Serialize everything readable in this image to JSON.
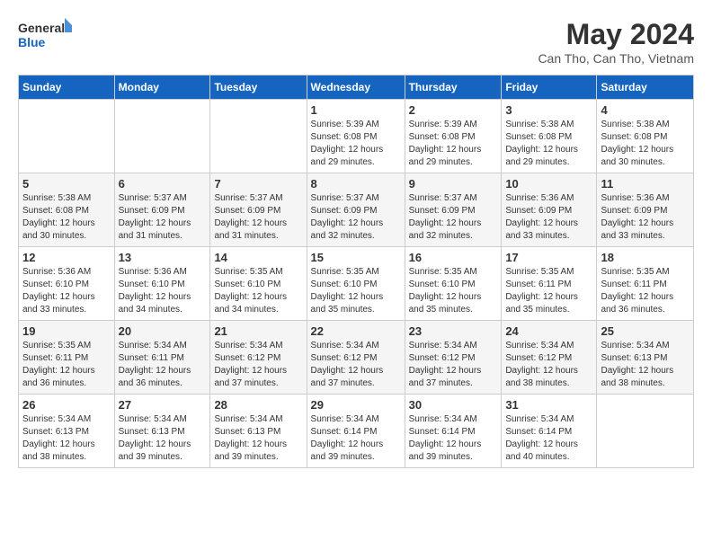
{
  "header": {
    "logo_line1": "General",
    "logo_line2": "Blue",
    "month_title": "May 2024",
    "location": "Can Tho, Can Tho, Vietnam"
  },
  "weekdays": [
    "Sunday",
    "Monday",
    "Tuesday",
    "Wednesday",
    "Thursday",
    "Friday",
    "Saturday"
  ],
  "weeks": [
    [
      {
        "day": "",
        "info": ""
      },
      {
        "day": "",
        "info": ""
      },
      {
        "day": "",
        "info": ""
      },
      {
        "day": "1",
        "info": "Sunrise: 5:39 AM\nSunset: 6:08 PM\nDaylight: 12 hours\nand 29 minutes."
      },
      {
        "day": "2",
        "info": "Sunrise: 5:39 AM\nSunset: 6:08 PM\nDaylight: 12 hours\nand 29 minutes."
      },
      {
        "day": "3",
        "info": "Sunrise: 5:38 AM\nSunset: 6:08 PM\nDaylight: 12 hours\nand 29 minutes."
      },
      {
        "day": "4",
        "info": "Sunrise: 5:38 AM\nSunset: 6:08 PM\nDaylight: 12 hours\nand 30 minutes."
      }
    ],
    [
      {
        "day": "5",
        "info": "Sunrise: 5:38 AM\nSunset: 6:08 PM\nDaylight: 12 hours\nand 30 minutes."
      },
      {
        "day": "6",
        "info": "Sunrise: 5:37 AM\nSunset: 6:09 PM\nDaylight: 12 hours\nand 31 minutes."
      },
      {
        "day": "7",
        "info": "Sunrise: 5:37 AM\nSunset: 6:09 PM\nDaylight: 12 hours\nand 31 minutes."
      },
      {
        "day": "8",
        "info": "Sunrise: 5:37 AM\nSunset: 6:09 PM\nDaylight: 12 hours\nand 32 minutes."
      },
      {
        "day": "9",
        "info": "Sunrise: 5:37 AM\nSunset: 6:09 PM\nDaylight: 12 hours\nand 32 minutes."
      },
      {
        "day": "10",
        "info": "Sunrise: 5:36 AM\nSunset: 6:09 PM\nDaylight: 12 hours\nand 33 minutes."
      },
      {
        "day": "11",
        "info": "Sunrise: 5:36 AM\nSunset: 6:09 PM\nDaylight: 12 hours\nand 33 minutes."
      }
    ],
    [
      {
        "day": "12",
        "info": "Sunrise: 5:36 AM\nSunset: 6:10 PM\nDaylight: 12 hours\nand 33 minutes."
      },
      {
        "day": "13",
        "info": "Sunrise: 5:36 AM\nSunset: 6:10 PM\nDaylight: 12 hours\nand 34 minutes."
      },
      {
        "day": "14",
        "info": "Sunrise: 5:35 AM\nSunset: 6:10 PM\nDaylight: 12 hours\nand 34 minutes."
      },
      {
        "day": "15",
        "info": "Sunrise: 5:35 AM\nSunset: 6:10 PM\nDaylight: 12 hours\nand 35 minutes."
      },
      {
        "day": "16",
        "info": "Sunrise: 5:35 AM\nSunset: 6:10 PM\nDaylight: 12 hours\nand 35 minutes."
      },
      {
        "day": "17",
        "info": "Sunrise: 5:35 AM\nSunset: 6:11 PM\nDaylight: 12 hours\nand 35 minutes."
      },
      {
        "day": "18",
        "info": "Sunrise: 5:35 AM\nSunset: 6:11 PM\nDaylight: 12 hours\nand 36 minutes."
      }
    ],
    [
      {
        "day": "19",
        "info": "Sunrise: 5:35 AM\nSunset: 6:11 PM\nDaylight: 12 hours\nand 36 minutes."
      },
      {
        "day": "20",
        "info": "Sunrise: 5:34 AM\nSunset: 6:11 PM\nDaylight: 12 hours\nand 36 minutes."
      },
      {
        "day": "21",
        "info": "Sunrise: 5:34 AM\nSunset: 6:12 PM\nDaylight: 12 hours\nand 37 minutes."
      },
      {
        "day": "22",
        "info": "Sunrise: 5:34 AM\nSunset: 6:12 PM\nDaylight: 12 hours\nand 37 minutes."
      },
      {
        "day": "23",
        "info": "Sunrise: 5:34 AM\nSunset: 6:12 PM\nDaylight: 12 hours\nand 37 minutes."
      },
      {
        "day": "24",
        "info": "Sunrise: 5:34 AM\nSunset: 6:12 PM\nDaylight: 12 hours\nand 38 minutes."
      },
      {
        "day": "25",
        "info": "Sunrise: 5:34 AM\nSunset: 6:13 PM\nDaylight: 12 hours\nand 38 minutes."
      }
    ],
    [
      {
        "day": "26",
        "info": "Sunrise: 5:34 AM\nSunset: 6:13 PM\nDaylight: 12 hours\nand 38 minutes."
      },
      {
        "day": "27",
        "info": "Sunrise: 5:34 AM\nSunset: 6:13 PM\nDaylight: 12 hours\nand 39 minutes."
      },
      {
        "day": "28",
        "info": "Sunrise: 5:34 AM\nSunset: 6:13 PM\nDaylight: 12 hours\nand 39 minutes."
      },
      {
        "day": "29",
        "info": "Sunrise: 5:34 AM\nSunset: 6:14 PM\nDaylight: 12 hours\nand 39 minutes."
      },
      {
        "day": "30",
        "info": "Sunrise: 5:34 AM\nSunset: 6:14 PM\nDaylight: 12 hours\nand 39 minutes."
      },
      {
        "day": "31",
        "info": "Sunrise: 5:34 AM\nSunset: 6:14 PM\nDaylight: 12 hours\nand 40 minutes."
      },
      {
        "day": "",
        "info": ""
      }
    ]
  ]
}
